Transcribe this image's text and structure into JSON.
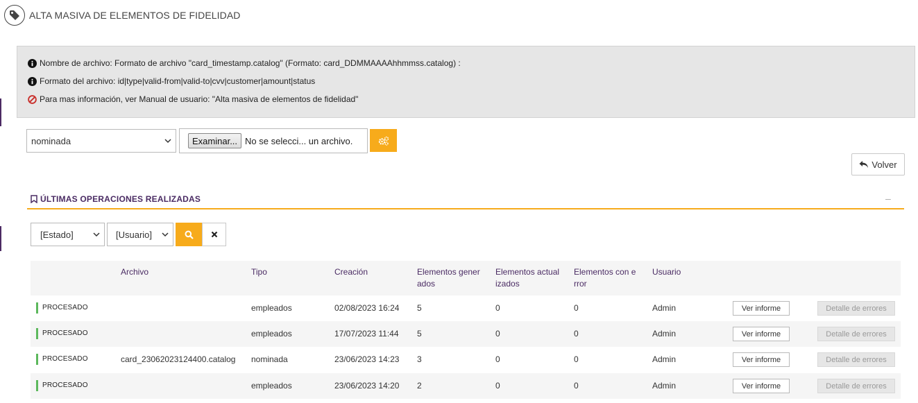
{
  "header": {
    "title": "ALTA MASIVA DE ELEMENTOS DE FIDELIDAD",
    "icon": "tag-icon"
  },
  "info": {
    "line1": "Nombre de archivo: Formato de archivo \"card_timestamp.catalog\" (Formato: card_DDMMAAAAhhmmss.catalog) :",
    "line2": "Formato del archivo: id|type|valid-from|valid-to|cvv|customer|amount|status",
    "line3": "Para mas información, ver Manual de usuario: \"Alta masiva de elementos de fidelidad\""
  },
  "form": {
    "type_selected": "nominada",
    "file_button": "Examinar...",
    "file_text": "No se selecci... un archivo."
  },
  "volver_label": "Volver",
  "section": {
    "title": "ÚLTIMAS OPERACIONES REALIZADAS",
    "collapse": "–"
  },
  "filters": {
    "estado": "[Estado]",
    "usuario": "[Usuario]"
  },
  "table": {
    "headers": {
      "archivo": "Archivo",
      "tipo": "Tipo",
      "creacion": "Creación",
      "generados": "Elementos gener ados",
      "actualizados": "Elementos actual izados",
      "error": "Elementos con e rror",
      "usuario": "Usuario"
    },
    "rows": [
      {
        "estado": "PROCESADO",
        "archivo": "",
        "tipo": "empleados",
        "creacion": "02/08/2023 16:24",
        "generados": "5",
        "actualizados": "0",
        "error": "0",
        "usuario": "Admin",
        "ver": "Ver informe",
        "detalle": "Detalle de errores"
      },
      {
        "estado": "PROCESADO",
        "archivo": "",
        "tipo": "empleados",
        "creacion": "17/07/2023 11:44",
        "generados": "5",
        "actualizados": "0",
        "error": "0",
        "usuario": "Admin",
        "ver": "Ver informe",
        "detalle": "Detalle de errores"
      },
      {
        "estado": "PROCESADO",
        "archivo": "card_23062023124400.catalog",
        "tipo": "nominada",
        "creacion": "23/06/2023 14:23",
        "generados": "3",
        "actualizados": "0",
        "error": "0",
        "usuario": "Admin",
        "ver": "Ver informe",
        "detalle": "Detalle de errores"
      },
      {
        "estado": "PROCESADO",
        "archivo": "",
        "tipo": "empleados",
        "creacion": "23/06/2023 14:20",
        "generados": "2",
        "actualizados": "0",
        "error": "0",
        "usuario": "Admin",
        "ver": "Ver informe",
        "detalle": "Detalle de errores"
      }
    ]
  },
  "colors": {
    "accent": "#f7ab1b",
    "brand": "#4a2b63",
    "status_ok": "#5cb85c"
  }
}
